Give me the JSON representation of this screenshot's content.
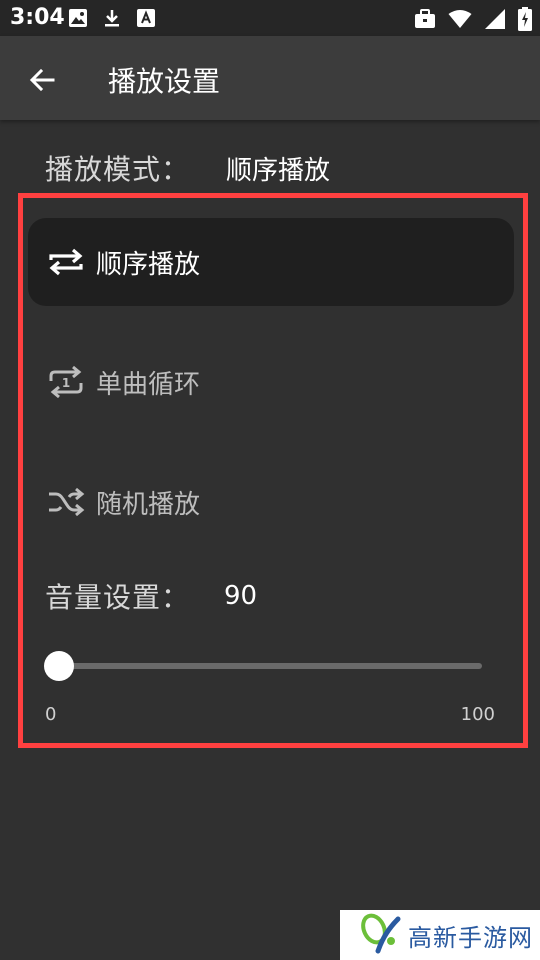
{
  "status_bar": {
    "time": "3:04",
    "left_icons": [
      "image-icon",
      "download-icon",
      "a-box-icon"
    ],
    "right_icons": [
      "briefcase-icon",
      "wifi-icon",
      "signal-icon",
      "battery-icon"
    ]
  },
  "app_bar": {
    "title": "播放设置",
    "back_icon": "arrow-left-icon"
  },
  "play_mode": {
    "label": "播放模式：",
    "value": "顺序播放",
    "options": [
      {
        "label": "顺序播放",
        "icon": "repeat-icon",
        "selected": true
      },
      {
        "label": "单曲循环",
        "icon": "repeat-one-icon",
        "selected": false
      },
      {
        "label": "随机播放",
        "icon": "shuffle-icon",
        "selected": false
      }
    ]
  },
  "volume": {
    "label": "音量设置：",
    "value": "90",
    "slider_fraction": 0,
    "min_label": "0",
    "max_label": "100"
  },
  "watermark": {
    "text": "高新手游网"
  },
  "colors": {
    "highlight": "#ff4040",
    "background": "#303030",
    "app_bar": "#3c3c3c",
    "status_bar": "#262626"
  }
}
